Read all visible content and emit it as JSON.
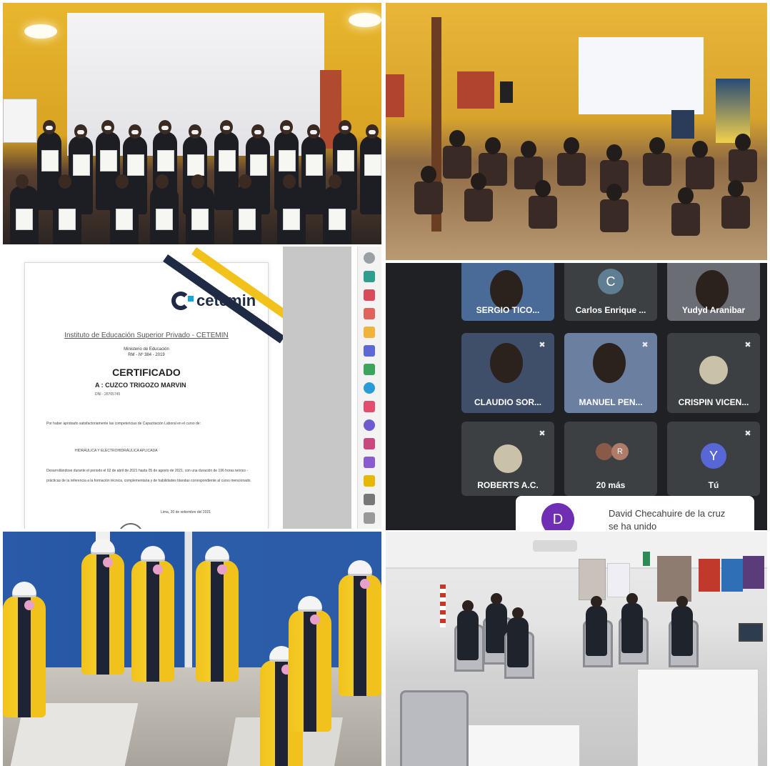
{
  "certificate": {
    "brand": "cetemin",
    "institute": "Instituto de Educación Superior Privado - CETEMIN",
    "ministry": "Ministerio de Educación",
    "rm": "RM - Nº 384 - 2019",
    "title": "CERTIFICADO",
    "recipient": "A  : CUZCO TRIGOZO MARVIN",
    "dni": "DNI - 28765745",
    "body1": "Por haber aprobado satisfactoriamente las competencias de Capacitación Laboral en el curso de:",
    "course": "HIDRÁULICA Y ELECTROHIDRÁULICA APLICADA",
    "body2": "Desarrollándose durante el periodo el 02 de abril de 2021 hasta 05 de agosto de 2021, con una duración de 196 horas teórico - prácticas de la referencia a la formación técnica, complementaria y de habilidades blandas correspondiente al curso mencionado.",
    "date": "Lima, 20 de setiembre del 2021"
  },
  "video_call": {
    "participants": [
      {
        "name": "SERGIO TICO...",
        "type": "photo"
      },
      {
        "name": "Carlos Enrique ...",
        "type": "letter",
        "letter": "C",
        "color": "#5f7e93"
      },
      {
        "name": "Yudyd Aranibar",
        "type": "photo"
      },
      {
        "name": "CLAUDIO SOR...",
        "type": "photo",
        "muted": true
      },
      {
        "name": "MANUEL PEN...",
        "type": "photo",
        "muted": true
      },
      {
        "name": "CRISPIN VICEN...",
        "type": "avatar",
        "muted": true
      },
      {
        "name": "ROBERTS A.C.",
        "type": "avatar",
        "muted": true
      },
      {
        "name": "20 más",
        "type": "group",
        "letter": "R"
      },
      {
        "name": "Tú",
        "type": "letter",
        "letter": "Y",
        "color": "#5867d6",
        "muted": true
      }
    ],
    "toast": {
      "letter": "D",
      "message": "David Checahuire de la cruz se ha unido"
    }
  }
}
